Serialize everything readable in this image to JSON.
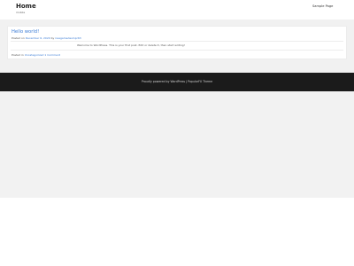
{
  "header": {
    "site_title": "Home",
    "site_description": "mobile",
    "menu_items": [
      "Sample Page"
    ]
  },
  "post": {
    "title": "Hello world!",
    "meta_prefix": "Posted on",
    "date": "December 6, 2020",
    "by": "by",
    "author": "ireagamedesmpr63",
    "body": "Welcome to WordPress. This is your first post. Edit or delete it, then start writing!",
    "footer_prefix": "Posted in",
    "category": "Uncategorized",
    "comments": "1 Comment"
  },
  "footer": {
    "credit": "Proudly powered by WordPress | PopularFX Theme"
  }
}
